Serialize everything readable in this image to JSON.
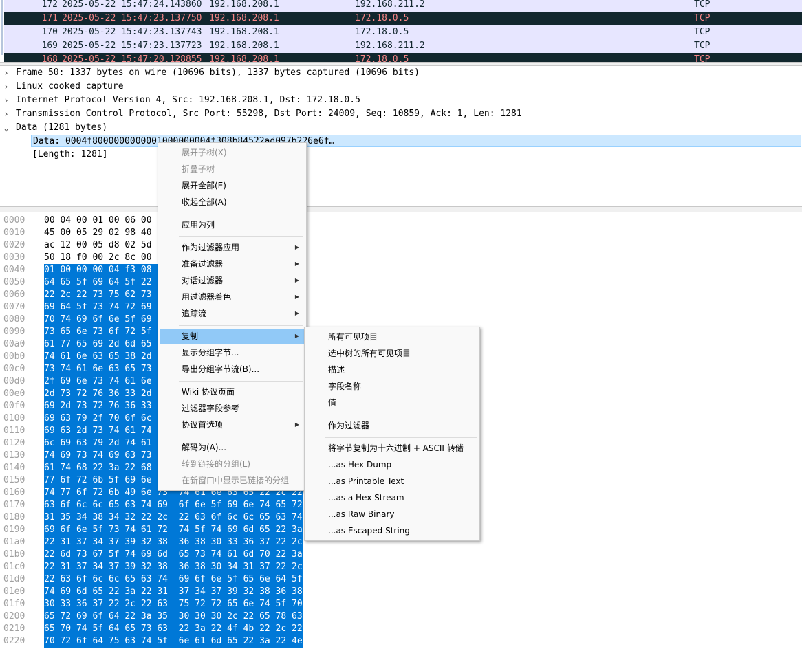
{
  "packets": [
    {
      "no": "172",
      "time": "2025-05-22 15:47:24.143860",
      "src": "192.168.208.1",
      "dst": "192.168.211.2",
      "proto": "TCP",
      "style": "tcp"
    },
    {
      "no": "171",
      "time": "2025-05-22 15:47:23.137750",
      "src": "192.168.208.1",
      "dst": "172.18.0.5",
      "proto": "TCP",
      "style": "err"
    },
    {
      "no": "170",
      "time": "2025-05-22 15:47:23.137743",
      "src": "192.168.208.1",
      "dst": "172.18.0.5",
      "proto": "TCP",
      "style": "tcp"
    },
    {
      "no": "169",
      "time": "2025-05-22 15:47:23.137723",
      "src": "192.168.208.1",
      "dst": "192.168.211.2",
      "proto": "TCP",
      "style": "tcp"
    },
    {
      "no": "168",
      "time": "2025-05-22 15:47:20.128855",
      "src": "192.168.208.1",
      "dst": "172.18.0.5",
      "proto": "TCP",
      "style": "err"
    }
  ],
  "details": {
    "rows": [
      {
        "arrow": "›",
        "text": "Frame 50: 1337 bytes on wire (10696 bits), 1337 bytes captured (10696 bits)"
      },
      {
        "arrow": "›",
        "text": "Linux cooked capture"
      },
      {
        "arrow": "›",
        "text": "Internet Protocol Version 4, Src: 192.168.208.1, Dst: 172.18.0.5"
      },
      {
        "arrow": "›",
        "text": "Transmission Control Protocol, Src Port: 55298, Dst Port: 24009, Seq: 10859, Ack: 1, Len: 1281"
      },
      {
        "arrow": "⌄",
        "text": "Data (1281 bytes)"
      }
    ],
    "children": [
      {
        "text": "Data: 0004f8000000000001000000004f308b84522ad097b226e6f…",
        "selected": true
      },
      {
        "text": "[Length: 1281]",
        "selected": false
      }
    ]
  },
  "hex": [
    {
      "off": "0000",
      "bytes": "00 04 00 01 00 06 00 15  5d 76 7b 50 00 00 08 00",
      "hl": false
    },
    {
      "off": "0010",
      "bytes": "45 00 05 29 02 98 40 00  7f 06 9c 4e c0 a8 d0 01",
      "hl": false
    },
    {
      "off": "0020",
      "bytes": "ac 12 00 05 d8 02 5d c9  8a a4 ae 03 63 72 46 41",
      "hl": false
    },
    {
      "off": "0030",
      "bytes": "50 18 f0 00 2c 8c 00 00  00 04 f8 00 00 00 00 00",
      "hl": false
    },
    {
      "off": "0040",
      "bytes": "01 00 00 00 04 f3 08 b8  45 22 ad 09 7b 22 6e 6f",
      "hl": true
    },
    {
      "off": "0050",
      "bytes": "64 65 5f 69 64 5f 22 3a  22 45 51 30 38 57 30 31",
      "hl": true
    },
    {
      "off": "0060",
      "bytes": "22 2c 22 73 75 62 73 63  72 69 70 74 69 6f 6e 5f",
      "hl": true
    },
    {
      "off": "0070",
      "bytes": "69 64 5f 73 74 72 69 6e  67 22 3a 22 73 63 72 69",
      "hl": true
    },
    {
      "off": "0080",
      "bytes": "70 74 69 6f 6e 5f 69 64  22 3a 22 69 69 22 2c 22",
      "hl": true
    },
    {
      "off": "0090",
      "bytes": "73 65 6e 73 6f 72 5f 69  64 22 3a 22 74 68 65 6e",
      "hl": true
    },
    {
      "off": "00a0",
      "bytes": "61 77 65 69 2d 6d 65 73  68 2d 73 65 6e 73 6f 72",
      "hl": true
    },
    {
      "off": "00b0",
      "bytes": "74 61 6e 63 65 38 2d 76  36 2e 34 2d 73 74 61 6e",
      "hl": true
    },
    {
      "off": "00c0",
      "bytes": "73 74 61 6e 63 65 73 2f  69 6e 73 74 61 6e 63 65",
      "hl": true
    },
    {
      "off": "00d0",
      "bytes": "2f 69 6e 73 74 61 6e 63  65 2f 73 76 63 2f 69 6e",
      "hl": true
    },
    {
      "off": "00e0",
      "bytes": "2d 73 72 76 36 33 2d 6d  65 73 68 2d 70 72 6f 78",
      "hl": true
    },
    {
      "off": "00f0",
      "bytes": "69 2d 73 72 76 36 33 2d  61 64 61 70 74 65 72 2f",
      "hl": true
    },
    {
      "off": "0100",
      "bytes": "69 63 79 2f 70 6f 6c 69  63 79 2d 73 72 76 36 33",
      "hl": true
    },
    {
      "off": "0110",
      "bytes": "69 63 2d 73 74 61 74 69  73 74 69 63 73 22 2c 22",
      "hl": true
    },
    {
      "off": "0120",
      "bytes": "6c 69 63 79 2d 74 61 67  5f 74 79 70 65 22 3a 22",
      "hl": true
    },
    {
      "off": "0130",
      "bytes": "74 69 73 74 69 63 73 22  2c 22 73 74 61 72 74 5f",
      "hl": true
    },
    {
      "off": "0140",
      "bytes": "61 74 68 22 3a 22 68 74  74 70 22 2c 22 6e 65 74",
      "hl": true
    },
    {
      "off": "0150",
      "bytes": "77 6f 72 6b 5f 69 6e 73  74 61 6e 63 65 22 3a 22",
      "hl": true
    },
    {
      "off": "0160",
      "bytes": "74 77 6f 72 6b 49 6e 73  74 61 6e 63 65 22 2c 22",
      "hl": true
    },
    {
      "off": "0170",
      "bytes": "63 6f 6c 6c 65 63 74 69  6f 6e 5f 69 6e 74 65 72",
      "hl": true
    },
    {
      "off": "0180",
      "bytes": "31 35 34 38 34 32 22 2c  22 63 6f 6c 6c 65 63 74",
      "hl": true
    },
    {
      "off": "0190",
      "bytes": "69 6f 6e 5f 73 74 61 72  74 5f 74 69 6d 65 22 3a",
      "hl": true
    },
    {
      "off": "01a0",
      "bytes": "22 31 37 34 37 39 32 38  36 38 30 33 36 37 22 2c",
      "hl": true
    },
    {
      "off": "01b0",
      "bytes": "22 6d 73 67 5f 74 69 6d  65 73 74 61 6d 70 22 3a",
      "hl": true
    },
    {
      "off": "01c0",
      "bytes": "22 31 37 34 37 39 32 38  36 38 30 34 31 37 22 2c",
      "hl": true
    },
    {
      "off": "01d0",
      "bytes": "22 63 6f 6c 6c 65 63 74  69 6f 6e 5f 65 6e 64 5f",
      "hl": true
    },
    {
      "off": "01e0",
      "bytes": "74 69 6d 65 22 3a 22 31  37 34 37 39 32 38 36 38",
      "hl": true
    },
    {
      "off": "01f0",
      "bytes": "30 33 36 37 22 2c 22 63  75 72 72 65 6e 74 5f 70",
      "hl": true
    },
    {
      "off": "0200",
      "bytes": "65 72 69 6f 64 22 3a 35  30 30 30 2c 22 65 78 63",
      "hl": true
    },
    {
      "off": "0210",
      "bytes": "65 70 74 5f 64 65 73 63  22 3a 22 4f 4b 22 2c 22",
      "hl": true
    },
    {
      "off": "0220",
      "bytes": "70 72 6f 64 75 63 74 5f  6e 61 6d 65 22 3a 22 4e",
      "hl": true
    }
  ],
  "context_menu": {
    "items": [
      {
        "label": "展开子树(X)",
        "disabled": true
      },
      {
        "label": "折叠子树",
        "disabled": true
      },
      {
        "label": "展开全部(E)"
      },
      {
        "label": "收起全部(A)"
      },
      {
        "sep": true
      },
      {
        "label": "应用为列"
      },
      {
        "sep": true
      },
      {
        "label": "作为过滤器应用",
        "sub": true
      },
      {
        "label": "准备过滤器",
        "sub": true
      },
      {
        "label": "对话过滤器",
        "sub": true
      },
      {
        "label": "用过滤器着色",
        "sub": true
      },
      {
        "label": "追踪流",
        "sub": true
      },
      {
        "sep": true
      },
      {
        "label": "复制",
        "sub": true,
        "active": true
      },
      {
        "label": "显示分组字节..."
      },
      {
        "label": "导出分组字节流(B)..."
      },
      {
        "sep": true
      },
      {
        "label": "Wiki 协议页面"
      },
      {
        "label": "过滤器字段参考"
      },
      {
        "label": "协议首选项",
        "sub": true
      },
      {
        "sep": true
      },
      {
        "label": "解码为(A)..."
      },
      {
        "label": "转到链接的分组(L)",
        "disabled": true
      },
      {
        "label": "在新窗口中显示已链接的分组",
        "disabled": true
      }
    ]
  },
  "copy_submenu": {
    "items": [
      {
        "label": "所有可见项目"
      },
      {
        "label": "选中树的所有可见项目"
      },
      {
        "label": "描述"
      },
      {
        "label": "字段名称"
      },
      {
        "label": "值"
      },
      {
        "sep": true
      },
      {
        "label": "作为过滤器"
      },
      {
        "sep": true
      },
      {
        "label": "将字节复制为十六进制 + ASCII 转储"
      },
      {
        "label": "...as Hex Dump"
      },
      {
        "label": "...as Printable Text"
      },
      {
        "label": "...as a Hex Stream"
      },
      {
        "label": "...as Raw Binary"
      },
      {
        "label": "...as Escaped String"
      }
    ]
  },
  "colors": {
    "tcp_row_bg": "#e7e6ff",
    "error_row_bg": "#12272e",
    "error_row_fg": "#f78787",
    "selection_bg": "#0078d7",
    "menu_active_bg": "#91c9f7"
  }
}
